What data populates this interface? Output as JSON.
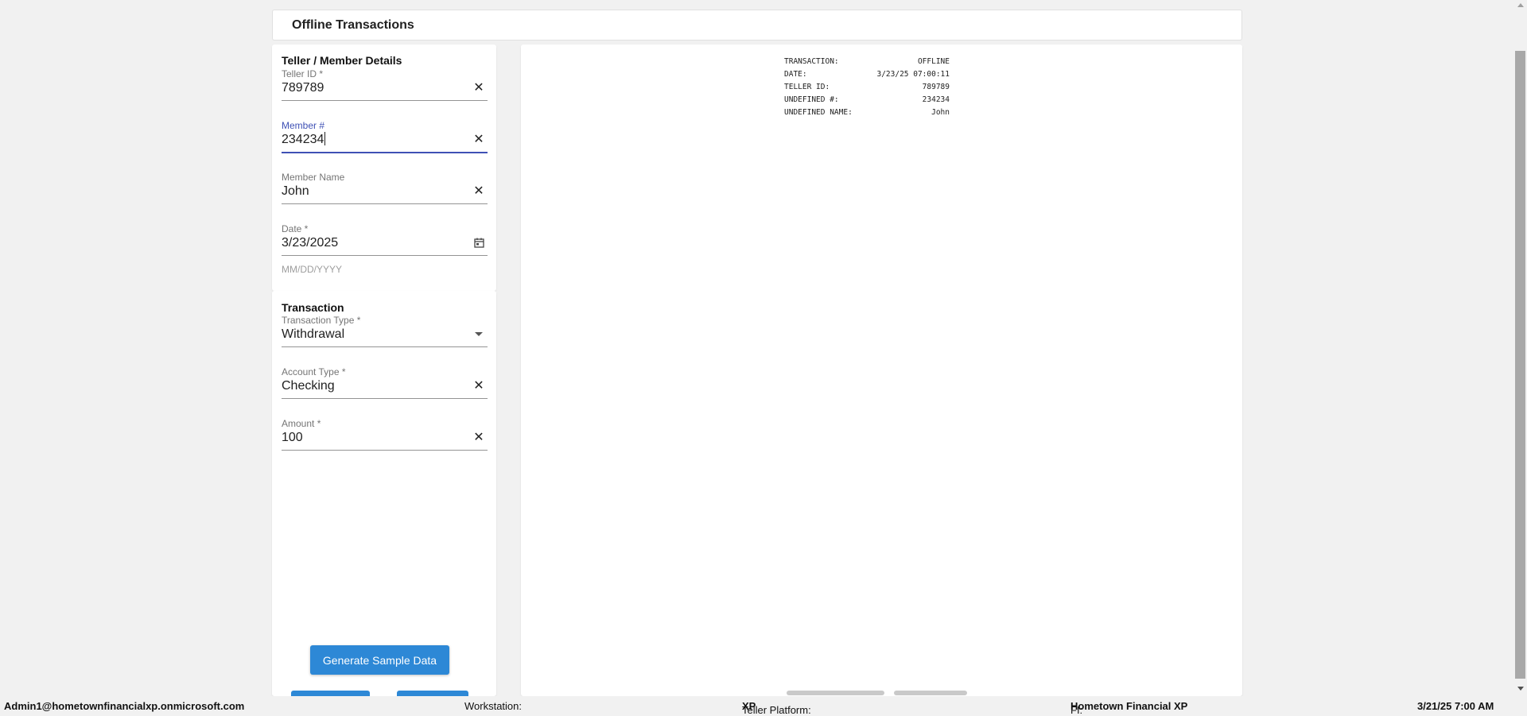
{
  "header": {
    "title": "Offline Transactions"
  },
  "details": {
    "title": "Teller / Member Details",
    "teller_id": {
      "label": "Teller ID *",
      "value": "789789"
    },
    "member_number": {
      "label": "Member #",
      "value": "234234"
    },
    "member_name": {
      "label": "Member Name",
      "value": "John"
    },
    "date": {
      "label": "Date *",
      "value": "3/23/2025",
      "helper": "MM/DD/YYYY"
    }
  },
  "transaction": {
    "title": "Transaction",
    "type": {
      "label": "Transaction Type *",
      "value": "Withdrawal"
    },
    "account_type": {
      "label": "Account Type *",
      "value": "Checking"
    },
    "amount": {
      "label": "Amount *",
      "value": "100"
    },
    "generate_label": "Generate Sample Data"
  },
  "receipt": {
    "rows": [
      {
        "key": "TRANSACTION:",
        "value": "OFFLINE"
      },
      {
        "key": "DATE:",
        "value": "3/23/25 07:00:11"
      },
      {
        "key": "TELLER ID:",
        "value": "789789"
      },
      {
        "key": "UNDEFINED #:",
        "value": "234234"
      },
      {
        "key": "UNDEFINED NAME:",
        "value": "John"
      }
    ]
  },
  "footer": {
    "user": "Admin1@hometownfinancialxp.onmicrosoft.com",
    "workstation_label": "Workstation:",
    "platform_label": "Teller Platform:",
    "platform_value": "XP",
    "fi_label": "FI:",
    "fi_value": "Hometown Financial XP",
    "datetime": "3/21/25 7:00 AM"
  },
  "icons": {
    "clear": "close-icon",
    "calendar": "calendar-icon",
    "dropdown": "chevron-down-icon"
  },
  "colors": {
    "primary": "#2d88d6",
    "focus": "#3f51b5"
  }
}
